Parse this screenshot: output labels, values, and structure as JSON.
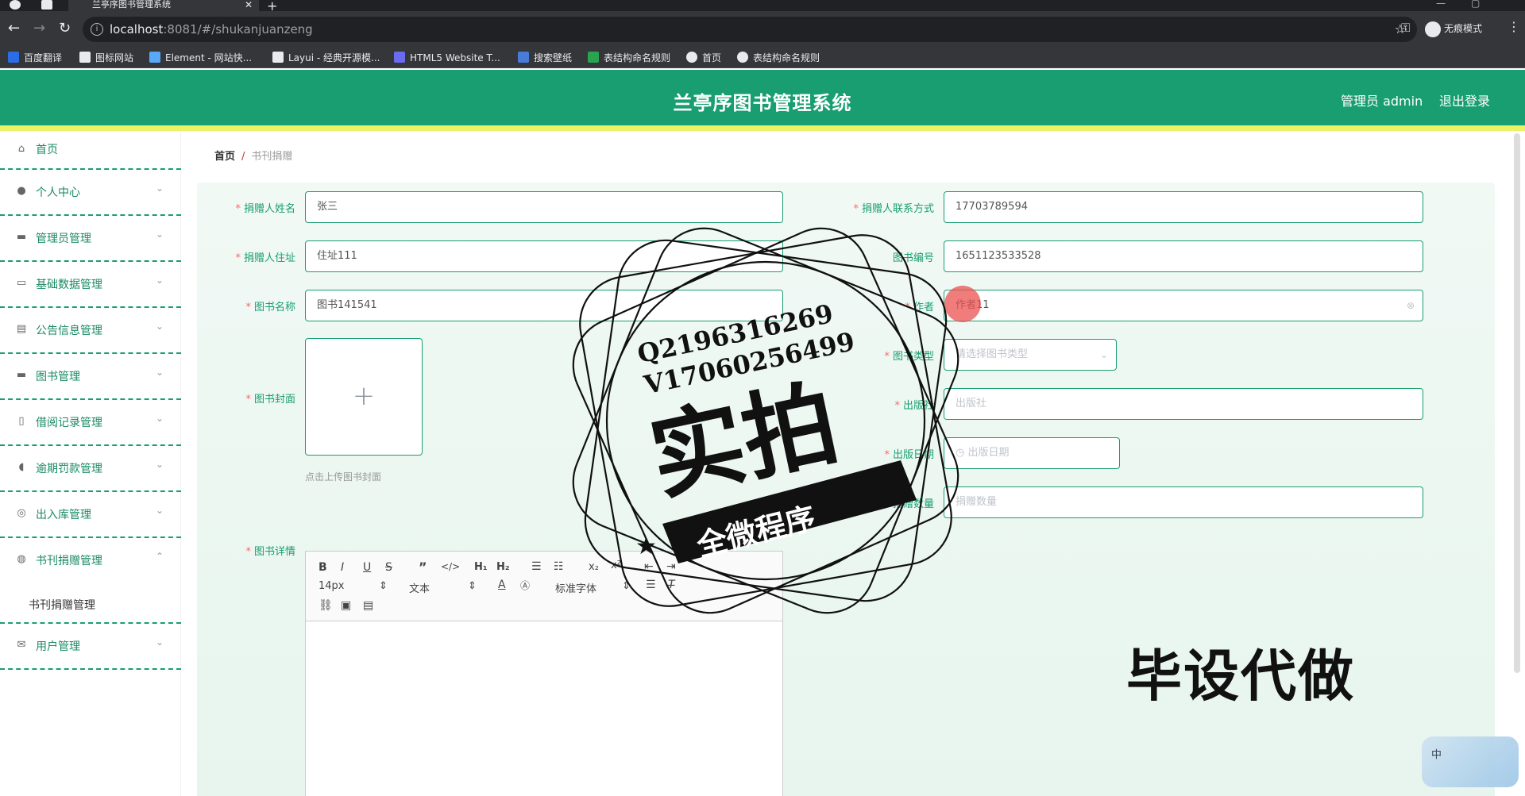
{
  "browser": {
    "tab_title": "兰亭序图书管理系统",
    "url_host": "localhost",
    "url_path": ":8081/#/shukanjuanzeng",
    "incognito_label": "无痕模式",
    "bookmarks": [
      {
        "label": "百度翻译",
        "color": "#2b6de5"
      },
      {
        "label": "图标网站",
        "color": "#e8eaed"
      },
      {
        "label": "Element - 网站快...",
        "color": "#5aa9f8"
      },
      {
        "label": "Layui - 经典开源模...",
        "color": "#e8eaed"
      },
      {
        "label": "HTML5 Website T...",
        "color": "#6b6bf1"
      },
      {
        "label": "搜索壁纸",
        "color": "#4a7bd8"
      },
      {
        "label": "表结构命名规则",
        "color": "#2aa44f"
      },
      {
        "label": "首页",
        "color": "#e8eaed"
      },
      {
        "label": "表结构命名规则",
        "color": "#e8eaed"
      }
    ]
  },
  "header": {
    "title": "兰亭序图书管理系统",
    "admin": "管理员 admin",
    "logout": "退出登录",
    "brand_color": "#189e70",
    "strip_color": "#ebf266"
  },
  "sidebar": {
    "home": "首页",
    "items": [
      {
        "label": "个人中心",
        "icon": "user-icon"
      },
      {
        "label": "管理员管理",
        "icon": "monitor-icon"
      },
      {
        "label": "基础数据管理",
        "icon": "chat-icon"
      },
      {
        "label": "公告信息管理",
        "icon": "clipboard-icon"
      },
      {
        "label": "图书管理",
        "icon": "message-icon"
      },
      {
        "label": "借阅记录管理",
        "icon": "phone-icon"
      },
      {
        "label": "逾期罚款管理",
        "icon": "pin-icon"
      },
      {
        "label": "出入库管理",
        "icon": "globe-icon"
      },
      {
        "label": "书刊捐赠管理",
        "icon": "dial-icon"
      }
    ],
    "active_sub": "书刊捐赠管理",
    "last_item": "用户管理"
  },
  "breadcrumb": {
    "home": "首页",
    "sep": "/",
    "current": "书刊捐赠"
  },
  "form": {
    "donor_name": {
      "label": "捐赠人姓名",
      "value": "张三"
    },
    "donor_contact": {
      "label": "捐赠人联系方式",
      "value": "17703789594"
    },
    "donor_address": {
      "label": "捐赠人住址",
      "value": "住址111"
    },
    "book_no": {
      "label": "图书编号",
      "value": "1651123533528"
    },
    "book_name": {
      "label": "图书名称",
      "value": "图书141541"
    },
    "author": {
      "label": "作者",
      "value": "作者11"
    },
    "book_type": {
      "label": "图书类型",
      "placeholder": "请选择图书类型"
    },
    "cover": {
      "label": "图书封面",
      "hint": "点击上传图书封面"
    },
    "publisher": {
      "label": "出版社",
      "placeholder": "出版社"
    },
    "publish_date": {
      "label": "出版日期",
      "placeholder": "出版日期"
    },
    "donate_count": {
      "label": "捐赠数量",
      "placeholder": "捐赠数量"
    },
    "details": {
      "label": "图书详情"
    }
  },
  "editor": {
    "size": "14px",
    "format": "文本",
    "font": "标准字体"
  },
  "watermarks": {
    "qq": "Q2196316269",
    "v": "V17060256499",
    "main": "实拍",
    "banner": "全微程序",
    "corner": "毕设代做",
    "ime": "中"
  }
}
